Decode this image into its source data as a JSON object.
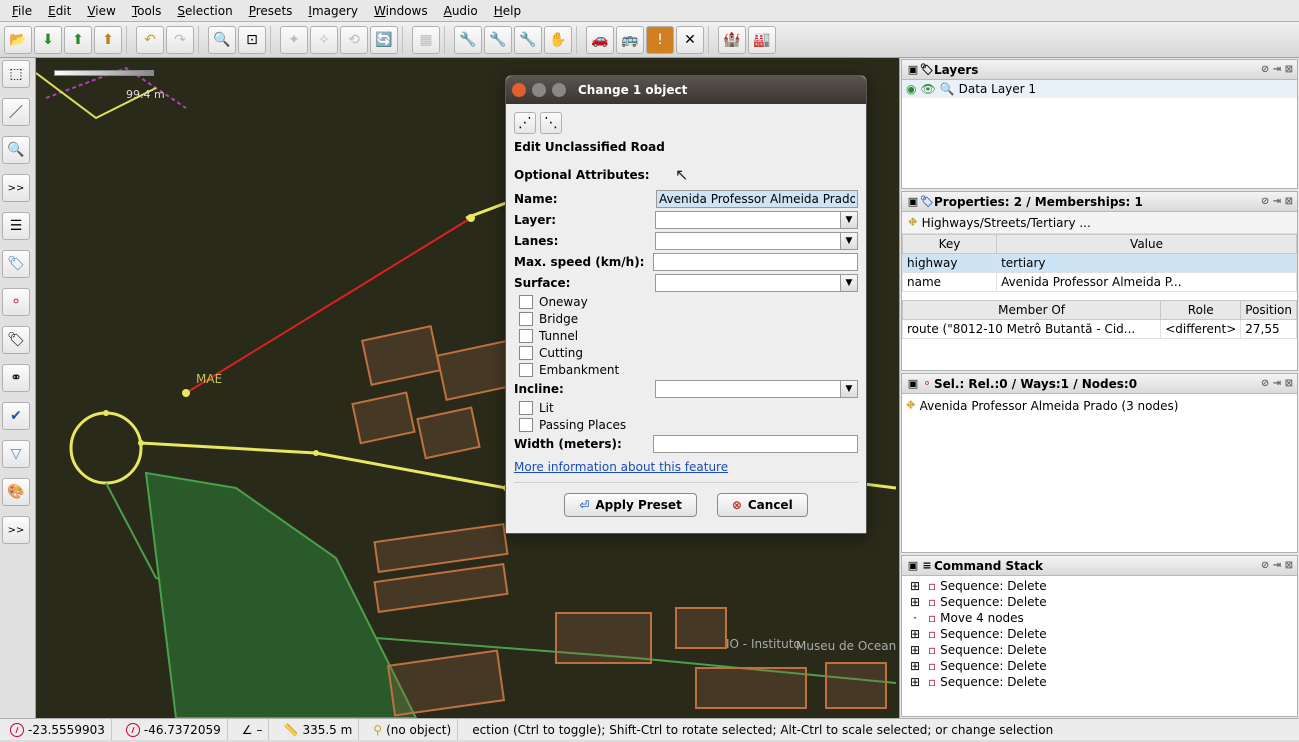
{
  "menu": [
    "File",
    "Edit",
    "View",
    "Tools",
    "Selection",
    "Presets",
    "Imagery",
    "Windows",
    "Audio",
    "Help"
  ],
  "toolbar_icons": [
    "folder-open",
    "download-green",
    "upload-green",
    "upload-orange",
    "",
    "undo",
    "redo",
    "",
    "zoom-in",
    "zoom-fit",
    "",
    "wand",
    "wand2",
    "rotate",
    "refresh",
    "",
    "grid",
    "",
    "wrench-y",
    "wrench-g",
    "wrench-o",
    "hand",
    "",
    "car",
    "bus",
    "warning",
    "tools-x",
    "",
    "castle",
    "factory"
  ],
  "left_icons": [
    "lasso",
    "",
    "poly",
    "",
    "zoom",
    "",
    ">>",
    "",
    "layers",
    "",
    "tag",
    "",
    "route",
    "",
    "tag2",
    "",
    "route2",
    "",
    "check",
    "",
    "funnel",
    "",
    "palette",
    "",
    ">>"
  ],
  "scale_text": "99.4 m",
  "map_label_mae": "MAE",
  "map_label_io": "IO - Instituto",
  "map_label_museu": "Museu de Oceanografia",
  "dialog": {
    "title": "Change 1 object",
    "heading": "Edit Unclassified Road",
    "optional_title": "Optional Attributes:",
    "fields": {
      "name_label": "Name:",
      "name_value": "Avenida Professor Almeida Prado",
      "layer_label": "Layer:",
      "lanes_label": "Lanes:",
      "maxspeed_label": "Max. speed (km/h):",
      "surface_label": "Surface:",
      "incline_label": "Incline:",
      "width_label": "Width (meters):"
    },
    "checks": [
      "Oneway",
      "Bridge",
      "Tunnel",
      "Cutting",
      "Embankment"
    ],
    "checks2": [
      "Lit",
      "Passing Places"
    ],
    "link": "More information about this feature",
    "apply": "Apply Preset",
    "cancel": "Cancel"
  },
  "layers_panel": {
    "title": "Layers",
    "item": "Data Layer 1"
  },
  "props_panel": {
    "title": "Properties: 2 / Memberships: 1",
    "preset_row": "Highways/Streets/Tertiary ...",
    "key_header": "Key",
    "value_header": "Value",
    "rows": [
      {
        "key": "highway",
        "value": "tertiary"
      },
      {
        "key": "name",
        "value": "Avenida Professor Almeida P..."
      }
    ],
    "member_headers": [
      "Member Of",
      "Role",
      "Position"
    ],
    "member_row": [
      "route (\"8012-10 Metrô Butantã - Cid...",
      "<different>",
      "27,55"
    ]
  },
  "sel_panel": {
    "title": "Sel.: Rel.:0 / Ways:1 / Nodes:0",
    "item": "Avenida Professor Almeida Prado (3 nodes)"
  },
  "cmd_panel": {
    "title": "Command Stack",
    "items": [
      "Sequence: Delete",
      "Sequence: Delete",
      "Move 4 nodes",
      "Sequence: Delete",
      "Sequence: Delete",
      "Sequence: Delete",
      "Sequence: Delete"
    ]
  },
  "status": {
    "lat": "-23.5559903",
    "lon": "-46.7372059",
    "angle_dash": "–",
    "dist": "335.5 m",
    "obj": "(no object)",
    "hint": "ection (Ctrl to toggle); Shift-Ctrl to rotate selected; Alt-Ctrl to scale selected; or change selection"
  }
}
